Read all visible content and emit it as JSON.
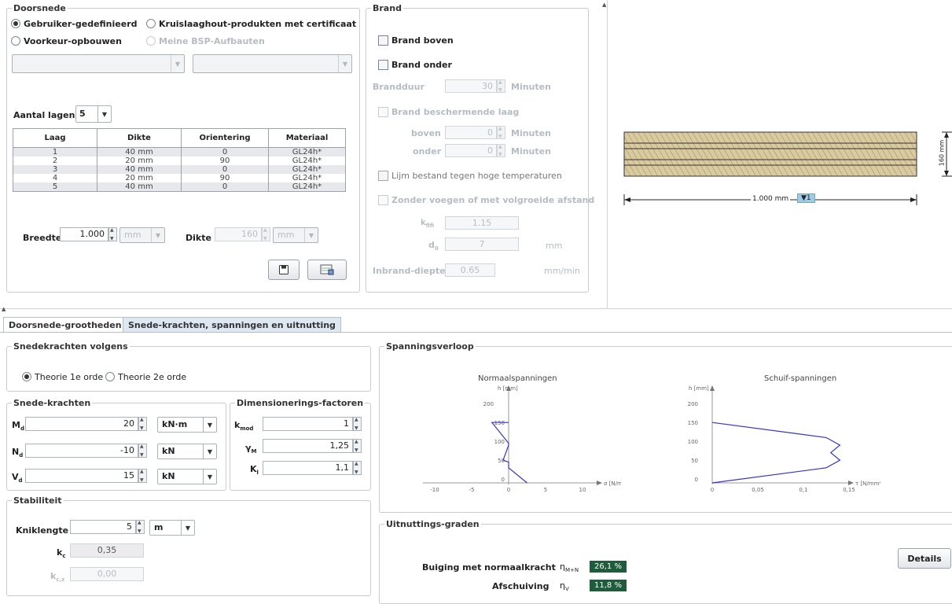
{
  "doorsnede": {
    "title": "Doorsnede",
    "opt_user": "Gebruiker-gedefinieerd",
    "opt_clt": "Kruislaaghout-produkten met certificaat",
    "opt_pref": "Voorkeur-opbouwen",
    "opt_bsp": "Meine BSP-Aufbauten",
    "aantal_label": "Aantal lagen",
    "aantal_value": "5",
    "columns": [
      "Laag",
      "Dikte",
      "Orientering",
      "Materiaal"
    ],
    "rows": [
      [
        "1",
        "40 mm",
        "0",
        "GL24h*"
      ],
      [
        "2",
        "20 mm",
        "90",
        "GL24h*"
      ],
      [
        "3",
        "40 mm",
        "0",
        "GL24h*"
      ],
      [
        "4",
        "20 mm",
        "90",
        "GL24h*"
      ],
      [
        "5",
        "40 mm",
        "0",
        "GL24h*"
      ]
    ],
    "breedte_label": "Breedte",
    "breedte_value": "1.000",
    "breedte_unit": "mm",
    "dikte_label": "Dikte",
    "dikte_value": "160",
    "dikte_unit": "mm"
  },
  "brand": {
    "title": "Brand",
    "boven": "Brand boven",
    "onder": "Brand onder",
    "brandduur_label": "Brandduur",
    "brandduur_value": "30",
    "minuten": "Minuten",
    "beschermlaag": "Brand beschermende laag",
    "boven_label": "boven",
    "boven_value": "0",
    "onder_label": "onder",
    "onder_value": "0",
    "lijm": "Lijm bestand tegen hoge temperaturen",
    "zonder": "Zonder voegen of met volgroeide afstand",
    "k_label": "k",
    "k_sub": "fifi",
    "k_value": "1.15",
    "d0_label": "d",
    "d0_sub": "0",
    "d0_value": "7",
    "d0_unit": "mm",
    "inbrand_label": "Inbrand-diepte",
    "inbrand_value": "0.65",
    "inbrand_unit": "mm/min"
  },
  "preview": {
    "width_label": "1.000 mm",
    "height_label": "160 mm",
    "tag": "▼1"
  },
  "tabs": {
    "tab1": "Doorsnede-grootheden",
    "tab2": "Snede-krachten, spanningen en uitnutting"
  },
  "snede": {
    "title": "Snedekrachten volgens",
    "theorie1": "Theorie 1e orde",
    "theorie2": "Theorie 2e orde",
    "krachten_title": "Snede-krachten",
    "md_label": "M",
    "md_sub": "d",
    "md_value": "20",
    "md_unit": "kN·m",
    "nd_label": "N",
    "nd_sub": "d",
    "nd_value": "-10",
    "nd_unit": "kN",
    "vd_label": "V",
    "vd_sub": "d",
    "vd_value": "15",
    "vd_unit": "kN",
    "dim_title": "Dimensionerings-factoren",
    "kmod_label": "k",
    "kmod_sub": "mod",
    "kmod_value": "1",
    "ym_label": "γ",
    "ym_sub": "M",
    "ym_value": "1,25",
    "kl_label": "K",
    "kl_sub": "l",
    "kl_value": "1,1"
  },
  "stab": {
    "title": "Stabiliteit",
    "knik_label": "Kniklengte",
    "knik_value": "5",
    "knik_unit": "m",
    "kc_label": "k",
    "kc_sub": "c",
    "kc_value": "0,35",
    "kcr_label": "k",
    "kcr_sub": "c,z",
    "kcr_value": "0,00"
  },
  "spanning": {
    "title": "Spanningsverloop",
    "normaal_title": "Normaalspanningen",
    "schuif_title": "Schuif-spanningen",
    "h_axis": "h [mm]",
    "sigma_axis": "σ [N/mm²]",
    "tau_axis": "τ [N/mm²]",
    "h_ticks": [
      "200",
      "150",
      "100",
      "50",
      "0"
    ],
    "sigma_ticks": [
      "-10",
      "-5",
      "0",
      "5",
      "10"
    ],
    "tau_ticks": [
      "0",
      "0,05",
      "0,1",
      "0,15"
    ]
  },
  "chart_data": [
    {
      "type": "line",
      "title": "Normaalspanningen",
      "xlabel": "σ [N/mm²]",
      "ylabel": "h [mm]",
      "xlim": [
        -12,
        12
      ],
      "ylim": [
        0,
        220
      ],
      "series": [
        {
          "x": [
            5,
            0,
            0,
            -1.5,
            0,
            0,
            -4.5,
            0
          ],
          "y": [
            0,
            40,
            55,
            60,
            100,
            105,
            160,
            160
          ]
        }
      ]
    },
    {
      "type": "line",
      "title": "Schuif-spanningen",
      "xlabel": "τ [N/mm²]",
      "ylabel": "h [mm]",
      "xlim": [
        0,
        0.18
      ],
      "ylim": [
        0,
        220
      ],
      "series": [
        {
          "x": [
            0,
            0.125,
            0.14,
            0.13,
            0.14,
            0.125,
            0
          ],
          "y": [
            0,
            40,
            60,
            80,
            100,
            120,
            160
          ]
        }
      ]
    }
  ],
  "uitnutting": {
    "title": "Uitnuttings-graden",
    "buiging_label": "Buiging met normaalkracht",
    "buiging_sym": "η",
    "buiging_sub": "M+N",
    "buiging_value": "26,1 %",
    "afschuiving_label": "Afschuiving",
    "afschuiving_sym": "η",
    "afschuiving_sub": "V",
    "afschuiving_value": "11,8 %",
    "details": "Details"
  },
  "colors": {
    "badge_green": "#1e5c3b",
    "chart_line": "#3333cc",
    "wood": "#d9caa0"
  }
}
